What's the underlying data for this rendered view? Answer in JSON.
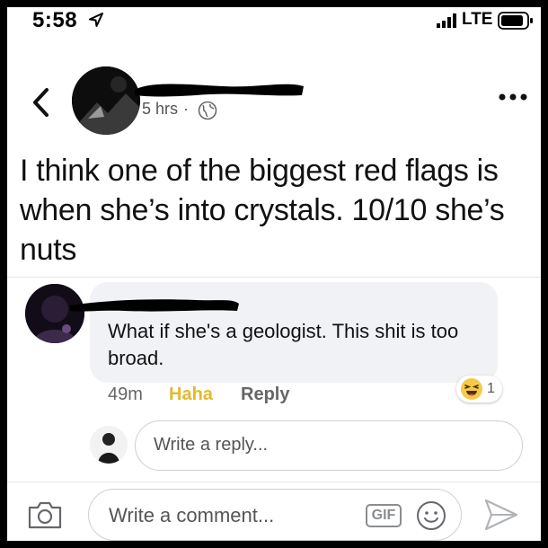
{
  "status_bar": {
    "time": "5:58",
    "carrier": "LTE",
    "icons": [
      "location-arrow-icon",
      "signal-bars-icon",
      "battery-icon"
    ]
  },
  "post": {
    "timestamp": "5 hrs",
    "separator": "·",
    "privacy_icon": "globe-icon",
    "text": "I think one of the biggest red flags is when she’s into crystals. 10/10 she’s nuts"
  },
  "comment": {
    "text": "What if she's a geologist. This shit is too broad.",
    "time": "49m",
    "reacted_label": "Haha",
    "reply_label": "Reply",
    "reaction_count": "1",
    "reaction_icon": "haha-emoji-icon"
  },
  "reply_box": {
    "placeholder": "Write a reply..."
  },
  "composer": {
    "placeholder": "Write a comment...",
    "gif_label": "GIF",
    "icons": [
      "camera-icon",
      "smiley-icon",
      "send-icon"
    ]
  },
  "colors": {
    "haha": "#e4b92c",
    "text": "#111111",
    "muted": "#666666",
    "bubble": "#f0f2f5"
  }
}
